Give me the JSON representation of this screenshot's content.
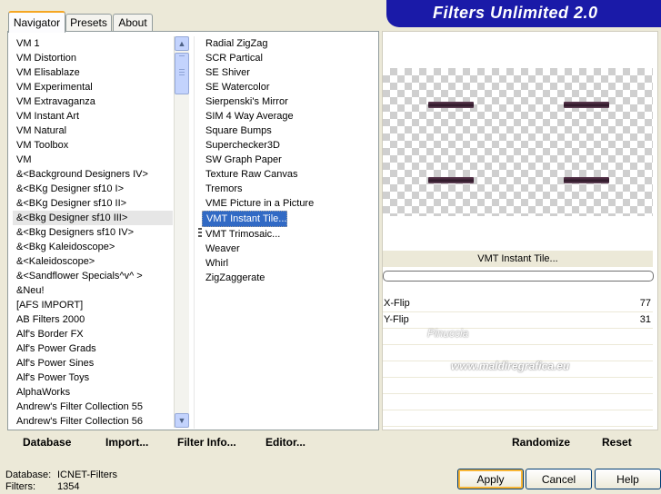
{
  "window": {
    "title": "Filters Unlimited 2.0",
    "title_color": "#1a1aa8"
  },
  "tabs": [
    {
      "label": "Navigator",
      "active": true
    },
    {
      "label": "Presets",
      "active": false
    },
    {
      "label": "About",
      "active": false
    }
  ],
  "categories": {
    "items": [
      "VM 1",
      "VM Distortion",
      "VM Elisablaze",
      "VM Experimental",
      "VM Extravaganza",
      "VM Instant Art",
      "VM Natural",
      "VM Toolbox",
      "VM",
      "&<Background Designers IV>",
      "&<BKg Designer sf10 I>",
      "&<BKg Designer sf10 II>",
      "&<Bkg Designer sf10 III>",
      "&<Bkg Designers sf10 IV>",
      "&<Bkg Kaleidoscope>",
      "&<Kaleidoscope>",
      "&<Sandflower Specials^v^ >",
      "&Neu!",
      "[AFS IMPORT]",
      "AB Filters 2000",
      "Alf's Border FX",
      "Alf's Power Grads",
      "Alf's Power Sines",
      "Alf's Power Toys",
      "AlphaWorks",
      "Andrew's Filter Collection 55",
      "Andrew's Filter Collection 56"
    ],
    "selected_index": 12
  },
  "filters": {
    "items": [
      "Radial ZigZag",
      "SCR  Partical",
      "SE Shiver",
      "SE Watercolor",
      "Sierpenski's Mirror",
      "SIM 4 Way Average",
      "Square Bumps",
      "Superchecker3D",
      "SW Graph Paper",
      "Texture Raw Canvas",
      "Tremors",
      "VME Picture in a Picture",
      "VMT Instant Tile...",
      "VMT Trimosaic...",
      "Weaver",
      "Whirl",
      "ZigZaggerate"
    ],
    "selected_index": 12,
    "selected_color": "#316ac5"
  },
  "preview": {
    "filter_name": "VMT Instant Tile...",
    "progress": 0
  },
  "parameters": [
    {
      "label": "X-Flip",
      "value": "77"
    },
    {
      "label": "Y-Flip",
      "value": "31"
    }
  ],
  "watermark": {
    "line1": "Pinuccia",
    "line2": "www.maldiregrafica.eu"
  },
  "toolbar": {
    "database": "Database",
    "import": "Import...",
    "filter_info": "Filter Info...",
    "editor": "Editor...",
    "randomize": "Randomize",
    "reset": "Reset"
  },
  "status": {
    "database_label": "Database:",
    "database_value": "ICNET-Filters",
    "filters_label": "Filters:",
    "filters_value": "1354"
  },
  "buttons": {
    "apply": "Apply",
    "cancel": "Cancel",
    "help": "Help"
  }
}
